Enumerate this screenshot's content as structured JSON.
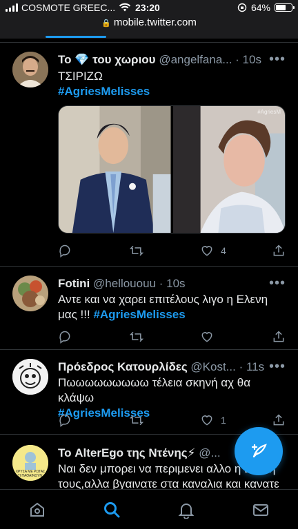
{
  "status": {
    "carrier": "COSMOTE GREEC...",
    "time": "23:20",
    "battery": "64%",
    "battery_level": 0.64
  },
  "browser": {
    "url": "mobile.twitter.com"
  },
  "tweets": [
    {
      "name_prefix": "Το",
      "name_emoji": "💎",
      "name_suffix": "του χωριου",
      "handle": "@angelfana...",
      "time": "· 10s",
      "text": "ΤΣΙΡΙΖΩ",
      "hashtag": "#AgriesMelisses",
      "watermark": "#AgriesM",
      "reply_count": "",
      "retweet_count": "",
      "like_count": "4"
    },
    {
      "name": "Fotini",
      "handle": "@hellououu",
      "time": "· 10s",
      "text": "Αντε και να χαρει επιτέλους λιγο η Ελενη μας !!!",
      "hashtag": "#AgriesMelisses"
    },
    {
      "name": "Πρόεδρος Κατουρλίδες",
      "handle": "@Kost...",
      "time": "· 11s",
      "text": "Πωωωωωωωωω τέλεια σκηνή αχ θα κλάψω",
      "hashtag": "#AgriesMelisses",
      "like_count": "1"
    },
    {
      "name": "Το AlterEgo της Ντένης⚡",
      "handle": "@...",
      "text_line1": "Ναι δεν μπορει να περιμενει αλλο η Ελενη",
      "text_line2": "τους,αλλα βγαινατε στα καναλια και κανατε",
      "avatar_text": "ΧΡΥΣΑ ΜΕ ΡΩΤΑΣ ΤΙ ΠΑΘΑΙΝΟΥΝ;"
    }
  ],
  "nav": {
    "items": [
      "home-icon",
      "search-icon",
      "notifications-icon",
      "messages-icon"
    ],
    "active": "search-icon"
  },
  "colors": {
    "accent": "#1d9bf0",
    "background": "#000000",
    "muted": "#8b98a5"
  }
}
